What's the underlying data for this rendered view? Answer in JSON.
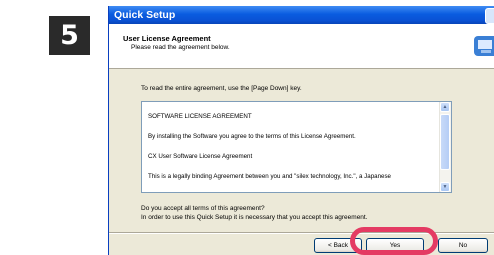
{
  "step": {
    "number": "5"
  },
  "window": {
    "title": "Quick Setup"
  },
  "header": {
    "title": "User License Agreement",
    "subtitle": "Please read the agreement below.",
    "icon": "setup-computer-icon"
  },
  "body": {
    "instruction": "To read the entire agreement, use the [Page Down] key.",
    "agreement_lines": [
      "SOFTWARE LICENSE AGREEMENT",
      "By installing the Software you agree to the terms of this License Agreement.",
      "CX User Software License Agreement",
      "This is a legally binding Agreement between you and \"silex technology, Inc.\", a Japanese"
    ],
    "question_line1": "Do you accept all terms of this agreement?",
    "question_line2": "In order to use this Quick Setup it is necessary that you accept this agreement."
  },
  "buttons": {
    "back": "< Back",
    "yes": "Yes",
    "no": "No"
  },
  "colors": {
    "title_bar": "#0a5ce0",
    "highlight": "#e43b63"
  }
}
